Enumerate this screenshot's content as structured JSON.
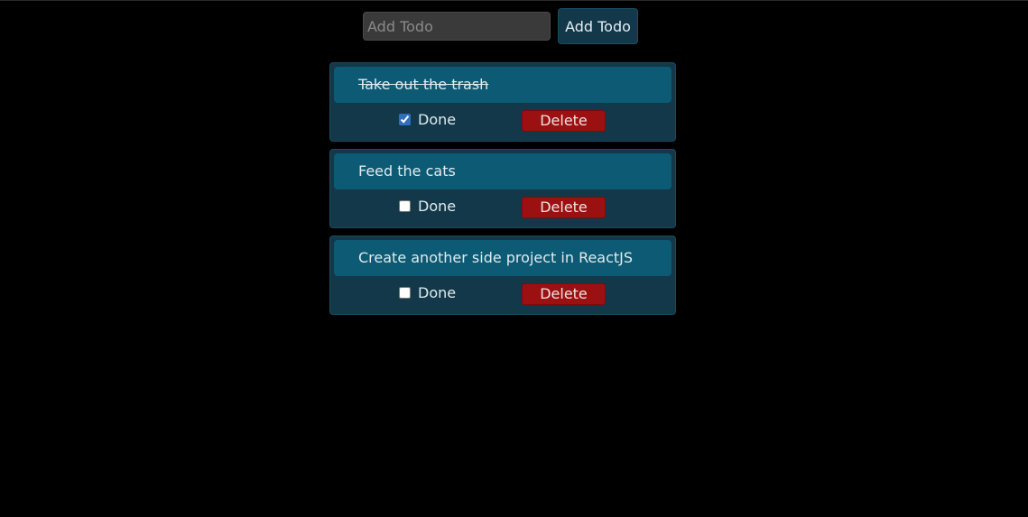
{
  "add_form": {
    "placeholder": "Add Todo",
    "value": "",
    "button_label": "Add Todo"
  },
  "todos": [
    {
      "title": "Take out the trash",
      "done": true,
      "done_label": "Done",
      "delete_label": "Delete"
    },
    {
      "title": "Feed the cats",
      "done": false,
      "done_label": "Done",
      "delete_label": "Delete"
    },
    {
      "title": "Create another side project in ReactJS",
      "done": false,
      "done_label": "Done",
      "delete_label": "Delete"
    }
  ],
  "colors": {
    "background": "#000000",
    "card": "#12384a",
    "title_bar": "#0c5a73",
    "delete": "#9b1111",
    "input": "#3a3a3a"
  }
}
